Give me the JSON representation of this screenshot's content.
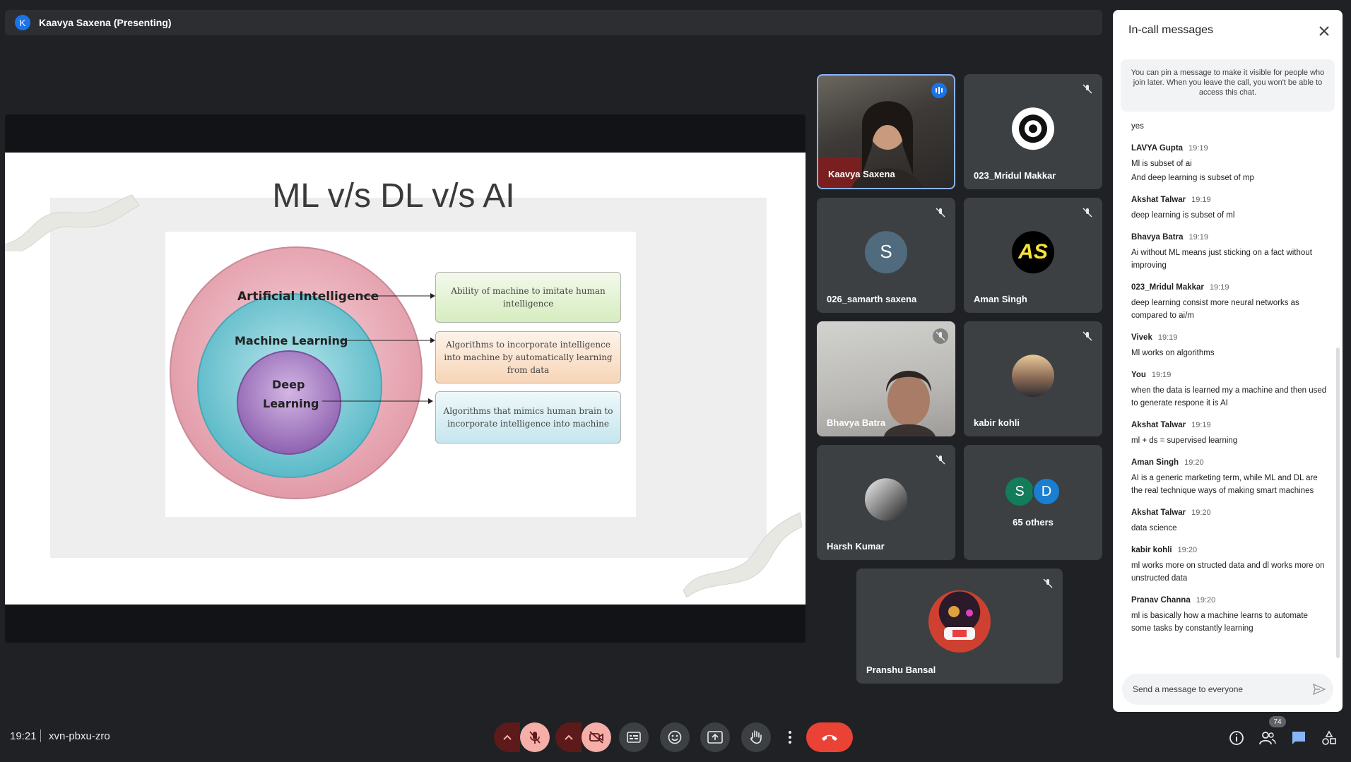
{
  "presenter": {
    "avatar_initial": "K",
    "name": "Kaavya Saxena (Presenting)"
  },
  "slide": {
    "title": "ML v/s DL v/s AI",
    "diagram": {
      "outer_label": "Artificial Intelligence",
      "middle_label": "Machine Learning",
      "inner_label_line1": "Deep",
      "inner_label_line2": "Learning",
      "box1": "Ability of machine to imitate human intelligence",
      "box2": "Algorithms to incorporate intelligence into machine by automatically learning from data",
      "box3": "Algorithms that mimics human brain to incorporate intelligence into machine",
      "colors": {
        "outer": "#e7a9b4",
        "middle": "#6cc3cf",
        "inner": "#a57cc2"
      }
    }
  },
  "participants": [
    {
      "name": "Kaavya Saxena",
      "type": "video",
      "active_speaker": true
    },
    {
      "name": "023_Mridul Makkar",
      "type": "avatar",
      "avatar": "lion-logo-icon",
      "muted": true
    },
    {
      "name": "026_samarth saxena",
      "type": "initial",
      "initial": "S",
      "color": "#4f6b7d",
      "muted": true
    },
    {
      "name": "Aman Singh",
      "type": "avatar",
      "avatar_text": "AS",
      "muted": true
    },
    {
      "name": "Bhavya Batra",
      "type": "video",
      "muted": true
    },
    {
      "name": "kabir kohli",
      "type": "avatar",
      "avatar": "landscape-photo",
      "muted": true
    },
    {
      "name": "Harsh Kumar",
      "type": "avatar",
      "avatar": "person-photo",
      "muted": true
    },
    {
      "name": "65 others",
      "type": "others",
      "initials": [
        "S",
        "D"
      ]
    },
    {
      "name": "Pranshu Bansal",
      "type": "avatar",
      "avatar": "illustration",
      "muted": true
    }
  ],
  "chat": {
    "title": "In-call messages",
    "note": "You can pin a message to make it visible for people who join later. When you leave the call, you won't be able to access this chat.",
    "messages": [
      {
        "sender": "",
        "time": "",
        "lines": [
          "yes"
        ]
      },
      {
        "sender": "LAVYA Gupta",
        "time": "19:19",
        "lines": [
          "Ml is subset of ai",
          "And deep learning is subset of mp"
        ]
      },
      {
        "sender": "Akshat Talwar",
        "time": "19:19",
        "lines": [
          "deep learning is subset of ml"
        ]
      },
      {
        "sender": "Bhavya Batra",
        "time": "19:19",
        "lines": [
          "Ai without ML means just sticking on a fact without improving"
        ]
      },
      {
        "sender": "023_Mridul Makkar",
        "time": "19:19",
        "lines": [
          "deep learning consist more neural networks as compared to ai/m"
        ]
      },
      {
        "sender": "Vivek",
        "time": "19:19",
        "lines": [
          "Ml works on algorithms"
        ]
      },
      {
        "sender": "You",
        "time": "19:19",
        "lines": [
          "when the data is learned my a machine and then used to generate respone it is AI"
        ]
      },
      {
        "sender": "Akshat Talwar",
        "time": "19:19",
        "lines": [
          "ml + ds = supervised learning"
        ]
      },
      {
        "sender": "Aman Singh",
        "time": "19:20",
        "lines": [
          "AI is a generic marketing term, while ML and DL are the real technique ways of making smart machines"
        ]
      },
      {
        "sender": "Akshat Talwar",
        "time": "19:20",
        "lines": [
          "data science"
        ]
      },
      {
        "sender": "kabir kohli",
        "time": "19:20",
        "lines": [
          "ml works more on structed data and dl works more on unstructed data"
        ]
      },
      {
        "sender": "Pranav Channa",
        "time": "19:20",
        "lines": [
          "ml is basically how a machine learns to automate some tasks by constantly learning"
        ]
      }
    ],
    "input_placeholder": "Send a message to everyone"
  },
  "bottom": {
    "time": "19:21",
    "meeting_code": "xvn-pbxu-zro",
    "people_count": "74"
  }
}
